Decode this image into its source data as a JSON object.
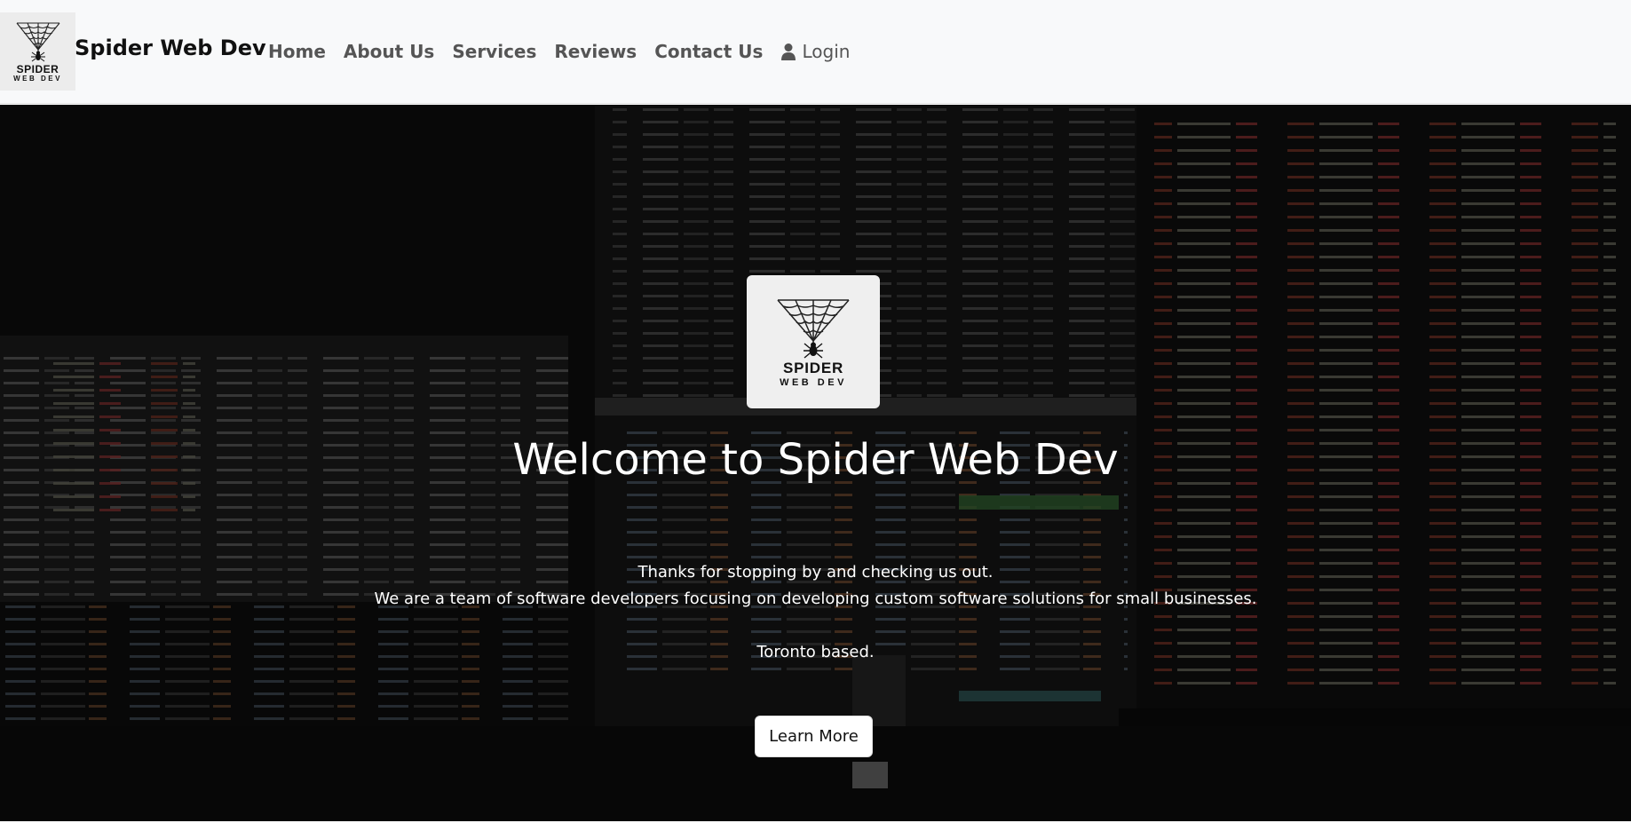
{
  "brand": {
    "logo_word1": "SPIDER",
    "logo_word2": "WEB DEV",
    "name": "Spider Web Dev",
    "logo_icon": "spider-web-icon"
  },
  "nav": {
    "items": [
      {
        "label": "Home"
      },
      {
        "label": "About Us"
      },
      {
        "label": "Services"
      },
      {
        "label": "Reviews"
      },
      {
        "label": "Contact Us"
      }
    ],
    "login_label": "Login",
    "login_icon": "user-icon"
  },
  "hero": {
    "logo_word1": "SPIDER",
    "logo_word2": "WEB DEV",
    "title": "Welcome to Spider Web Dev",
    "line1": "Thanks for stopping by and checking us out.",
    "line2": "We are a team of software developers focusing on developing custom software solutions for small businesses.",
    "line3": "Toronto based.",
    "button_label": "Learn More",
    "background": "dark photo of computer monitors showing code"
  },
  "colors": {
    "navbar_bg": "#f8f9fa",
    "nav_text": "#555555",
    "hero_text": "#ffffff",
    "button_bg": "#ffffff"
  }
}
